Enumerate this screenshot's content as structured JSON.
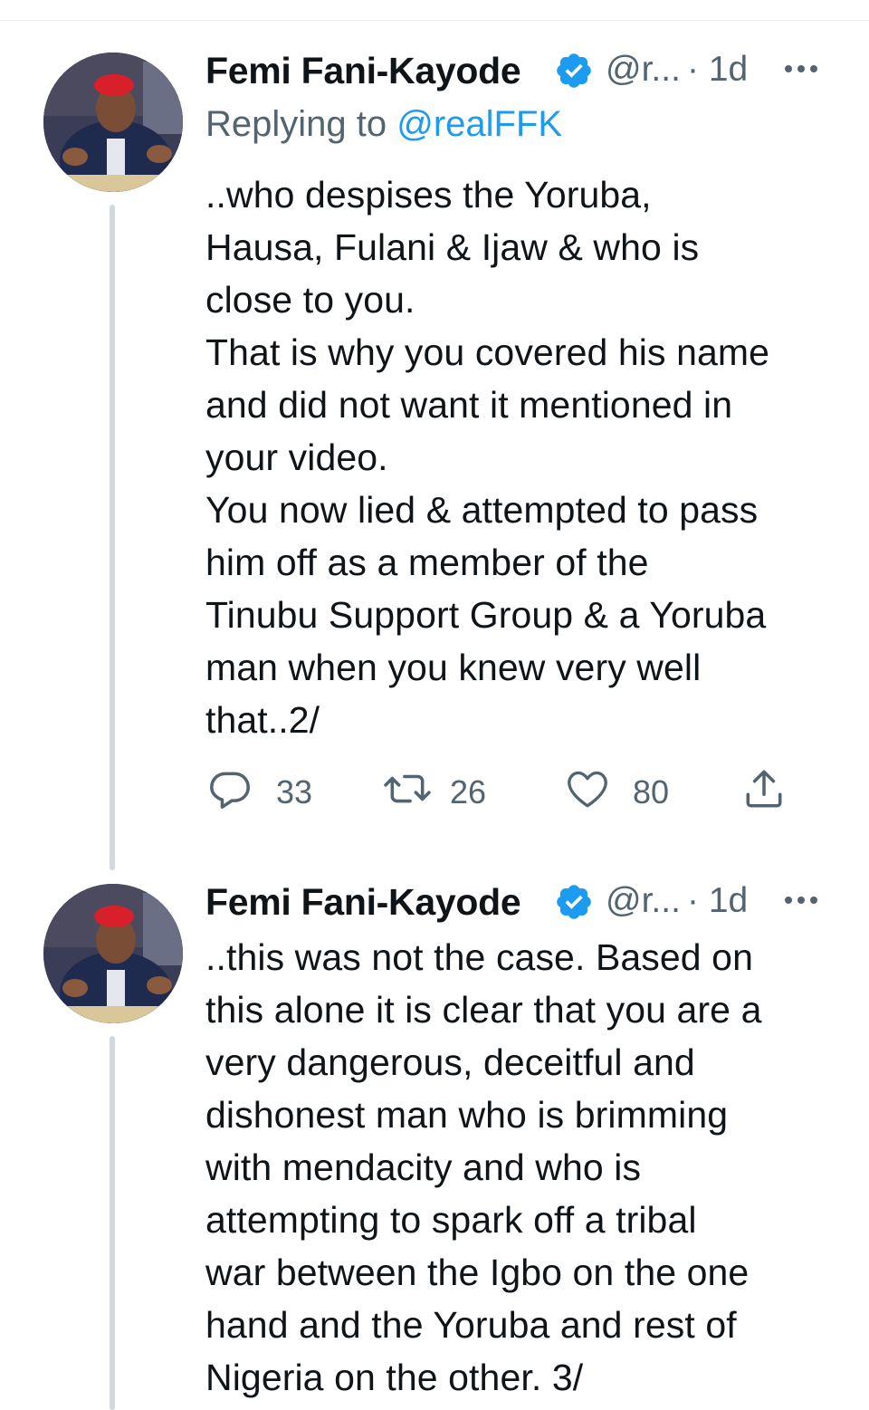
{
  "tweets": [
    {
      "author_name": "Femi Fani-Kayode",
      "handle": "@r...",
      "time": "· 1d",
      "replying_prefix": "Replying to",
      "replying_to": "@realFFK",
      "lines": [
        "..who despises the Yoruba,",
        "Hausa, Fulani & Ijaw & who is",
        "close to you.",
        "That is why you covered his name",
        "and did not want it mentioned in",
        "your video.",
        "You now lied & attempted to pass",
        "him off as a member of the",
        "Tinubu Support Group & a Yoruba",
        "man when you knew very well",
        "that..2/"
      ],
      "replies": "33",
      "retweets": "26",
      "likes": "80"
    },
    {
      "author_name": "Femi Fani-Kayode",
      "handle": "@r...",
      "time": "· 1d",
      "lines": [
        "..this was not the case. Based on",
        "this alone it is clear that you are a",
        "very dangerous, deceitful and",
        "dishonest man who is brimming",
        "with mendacity and who is",
        "attempting to spark off a tribal",
        "war between the Igbo on the one",
        "hand and the Yoruba and rest of",
        "Nigeria on the other. 3/"
      ]
    }
  ],
  "icons": [
    "verified-badge-icon",
    "more-options-icon",
    "reply-icon",
    "retweet-icon",
    "like-icon",
    "share-icon"
  ],
  "colors": {
    "verified": "#1d9bf0",
    "muted": "#536471",
    "link": "#1d9bf0",
    "thread_line": "#cfd9de"
  }
}
